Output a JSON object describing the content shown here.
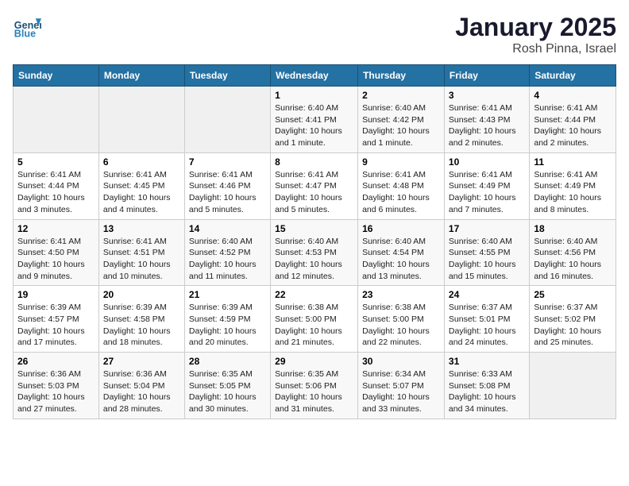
{
  "header": {
    "logo_general": "General",
    "logo_blue": "Blue",
    "title": "January 2025",
    "subtitle": "Rosh Pinna, Israel"
  },
  "days_of_week": [
    "Sunday",
    "Monday",
    "Tuesday",
    "Wednesday",
    "Thursday",
    "Friday",
    "Saturday"
  ],
  "weeks": [
    [
      {
        "day": "",
        "info": ""
      },
      {
        "day": "",
        "info": ""
      },
      {
        "day": "",
        "info": ""
      },
      {
        "day": "1",
        "info": "Sunrise: 6:40 AM\nSunset: 4:41 PM\nDaylight: 10 hours\nand 1 minute."
      },
      {
        "day": "2",
        "info": "Sunrise: 6:40 AM\nSunset: 4:42 PM\nDaylight: 10 hours\nand 1 minute."
      },
      {
        "day": "3",
        "info": "Sunrise: 6:41 AM\nSunset: 4:43 PM\nDaylight: 10 hours\nand 2 minutes."
      },
      {
        "day": "4",
        "info": "Sunrise: 6:41 AM\nSunset: 4:44 PM\nDaylight: 10 hours\nand 2 minutes."
      }
    ],
    [
      {
        "day": "5",
        "info": "Sunrise: 6:41 AM\nSunset: 4:44 PM\nDaylight: 10 hours\nand 3 minutes."
      },
      {
        "day": "6",
        "info": "Sunrise: 6:41 AM\nSunset: 4:45 PM\nDaylight: 10 hours\nand 4 minutes."
      },
      {
        "day": "7",
        "info": "Sunrise: 6:41 AM\nSunset: 4:46 PM\nDaylight: 10 hours\nand 5 minutes."
      },
      {
        "day": "8",
        "info": "Sunrise: 6:41 AM\nSunset: 4:47 PM\nDaylight: 10 hours\nand 5 minutes."
      },
      {
        "day": "9",
        "info": "Sunrise: 6:41 AM\nSunset: 4:48 PM\nDaylight: 10 hours\nand 6 minutes."
      },
      {
        "day": "10",
        "info": "Sunrise: 6:41 AM\nSunset: 4:49 PM\nDaylight: 10 hours\nand 7 minutes."
      },
      {
        "day": "11",
        "info": "Sunrise: 6:41 AM\nSunset: 4:49 PM\nDaylight: 10 hours\nand 8 minutes."
      }
    ],
    [
      {
        "day": "12",
        "info": "Sunrise: 6:41 AM\nSunset: 4:50 PM\nDaylight: 10 hours\nand 9 minutes."
      },
      {
        "day": "13",
        "info": "Sunrise: 6:41 AM\nSunset: 4:51 PM\nDaylight: 10 hours\nand 10 minutes."
      },
      {
        "day": "14",
        "info": "Sunrise: 6:40 AM\nSunset: 4:52 PM\nDaylight: 10 hours\nand 11 minutes."
      },
      {
        "day": "15",
        "info": "Sunrise: 6:40 AM\nSunset: 4:53 PM\nDaylight: 10 hours\nand 12 minutes."
      },
      {
        "day": "16",
        "info": "Sunrise: 6:40 AM\nSunset: 4:54 PM\nDaylight: 10 hours\nand 13 minutes."
      },
      {
        "day": "17",
        "info": "Sunrise: 6:40 AM\nSunset: 4:55 PM\nDaylight: 10 hours\nand 15 minutes."
      },
      {
        "day": "18",
        "info": "Sunrise: 6:40 AM\nSunset: 4:56 PM\nDaylight: 10 hours\nand 16 minutes."
      }
    ],
    [
      {
        "day": "19",
        "info": "Sunrise: 6:39 AM\nSunset: 4:57 PM\nDaylight: 10 hours\nand 17 minutes."
      },
      {
        "day": "20",
        "info": "Sunrise: 6:39 AM\nSunset: 4:58 PM\nDaylight: 10 hours\nand 18 minutes."
      },
      {
        "day": "21",
        "info": "Sunrise: 6:39 AM\nSunset: 4:59 PM\nDaylight: 10 hours\nand 20 minutes."
      },
      {
        "day": "22",
        "info": "Sunrise: 6:38 AM\nSunset: 5:00 PM\nDaylight: 10 hours\nand 21 minutes."
      },
      {
        "day": "23",
        "info": "Sunrise: 6:38 AM\nSunset: 5:00 PM\nDaylight: 10 hours\nand 22 minutes."
      },
      {
        "day": "24",
        "info": "Sunrise: 6:37 AM\nSunset: 5:01 PM\nDaylight: 10 hours\nand 24 minutes."
      },
      {
        "day": "25",
        "info": "Sunrise: 6:37 AM\nSunset: 5:02 PM\nDaylight: 10 hours\nand 25 minutes."
      }
    ],
    [
      {
        "day": "26",
        "info": "Sunrise: 6:36 AM\nSunset: 5:03 PM\nDaylight: 10 hours\nand 27 minutes."
      },
      {
        "day": "27",
        "info": "Sunrise: 6:36 AM\nSunset: 5:04 PM\nDaylight: 10 hours\nand 28 minutes."
      },
      {
        "day": "28",
        "info": "Sunrise: 6:35 AM\nSunset: 5:05 PM\nDaylight: 10 hours\nand 30 minutes."
      },
      {
        "day": "29",
        "info": "Sunrise: 6:35 AM\nSunset: 5:06 PM\nDaylight: 10 hours\nand 31 minutes."
      },
      {
        "day": "30",
        "info": "Sunrise: 6:34 AM\nSunset: 5:07 PM\nDaylight: 10 hours\nand 33 minutes."
      },
      {
        "day": "31",
        "info": "Sunrise: 6:33 AM\nSunset: 5:08 PM\nDaylight: 10 hours\nand 34 minutes."
      },
      {
        "day": "",
        "info": ""
      }
    ]
  ]
}
